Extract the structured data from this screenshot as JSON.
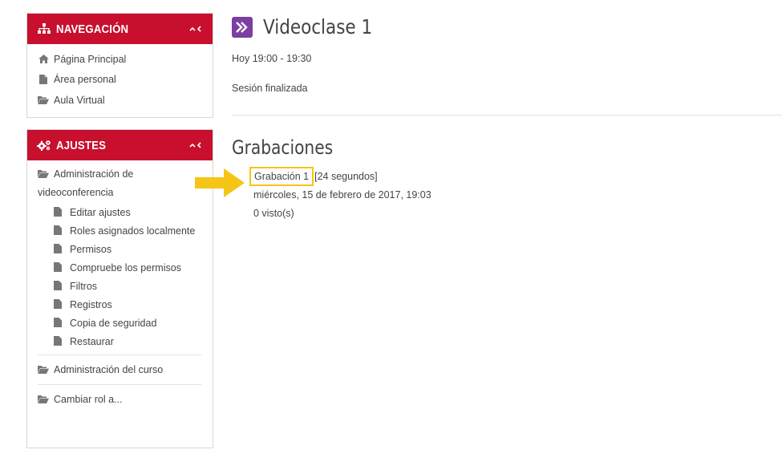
{
  "navigation": {
    "title": "NAVEGACIÓN",
    "items": [
      {
        "label": "Página Principal",
        "icon": "home-icon"
      },
      {
        "label": "Área personal",
        "icon": "file-icon"
      },
      {
        "label": "Aula Virtual",
        "icon": "folder-open-icon"
      }
    ]
  },
  "settings": {
    "title": "AJUSTES",
    "videoconf_admin": "Administración de videoconferencia",
    "sub_items": [
      {
        "label": "Editar ajustes"
      },
      {
        "label": "Roles asignados localmente"
      },
      {
        "label": "Permisos"
      },
      {
        "label": "Compruebe los permisos"
      },
      {
        "label": "Filtros"
      },
      {
        "label": "Registros"
      },
      {
        "label": "Copia de seguridad"
      },
      {
        "label": "Restaurar"
      }
    ],
    "course_admin": "Administración del curso",
    "switch_role": "Cambiar rol a..."
  },
  "main": {
    "title": "Videoclase 1",
    "time": "Hoy 19:00 - 19:30",
    "status": "Sesión finalizada",
    "recordings_title": "Grabaciones",
    "recording": {
      "link": "Grabación 1",
      "duration": "[24 segundos]",
      "date": "miércoles, 15 de febrero de 2017, 19:03",
      "views": "0 visto(s)"
    }
  },
  "colors": {
    "header_red": "#c8102e",
    "title_icon_purple": "#7a3fa0",
    "highlight_yellow": "#f5c518"
  }
}
